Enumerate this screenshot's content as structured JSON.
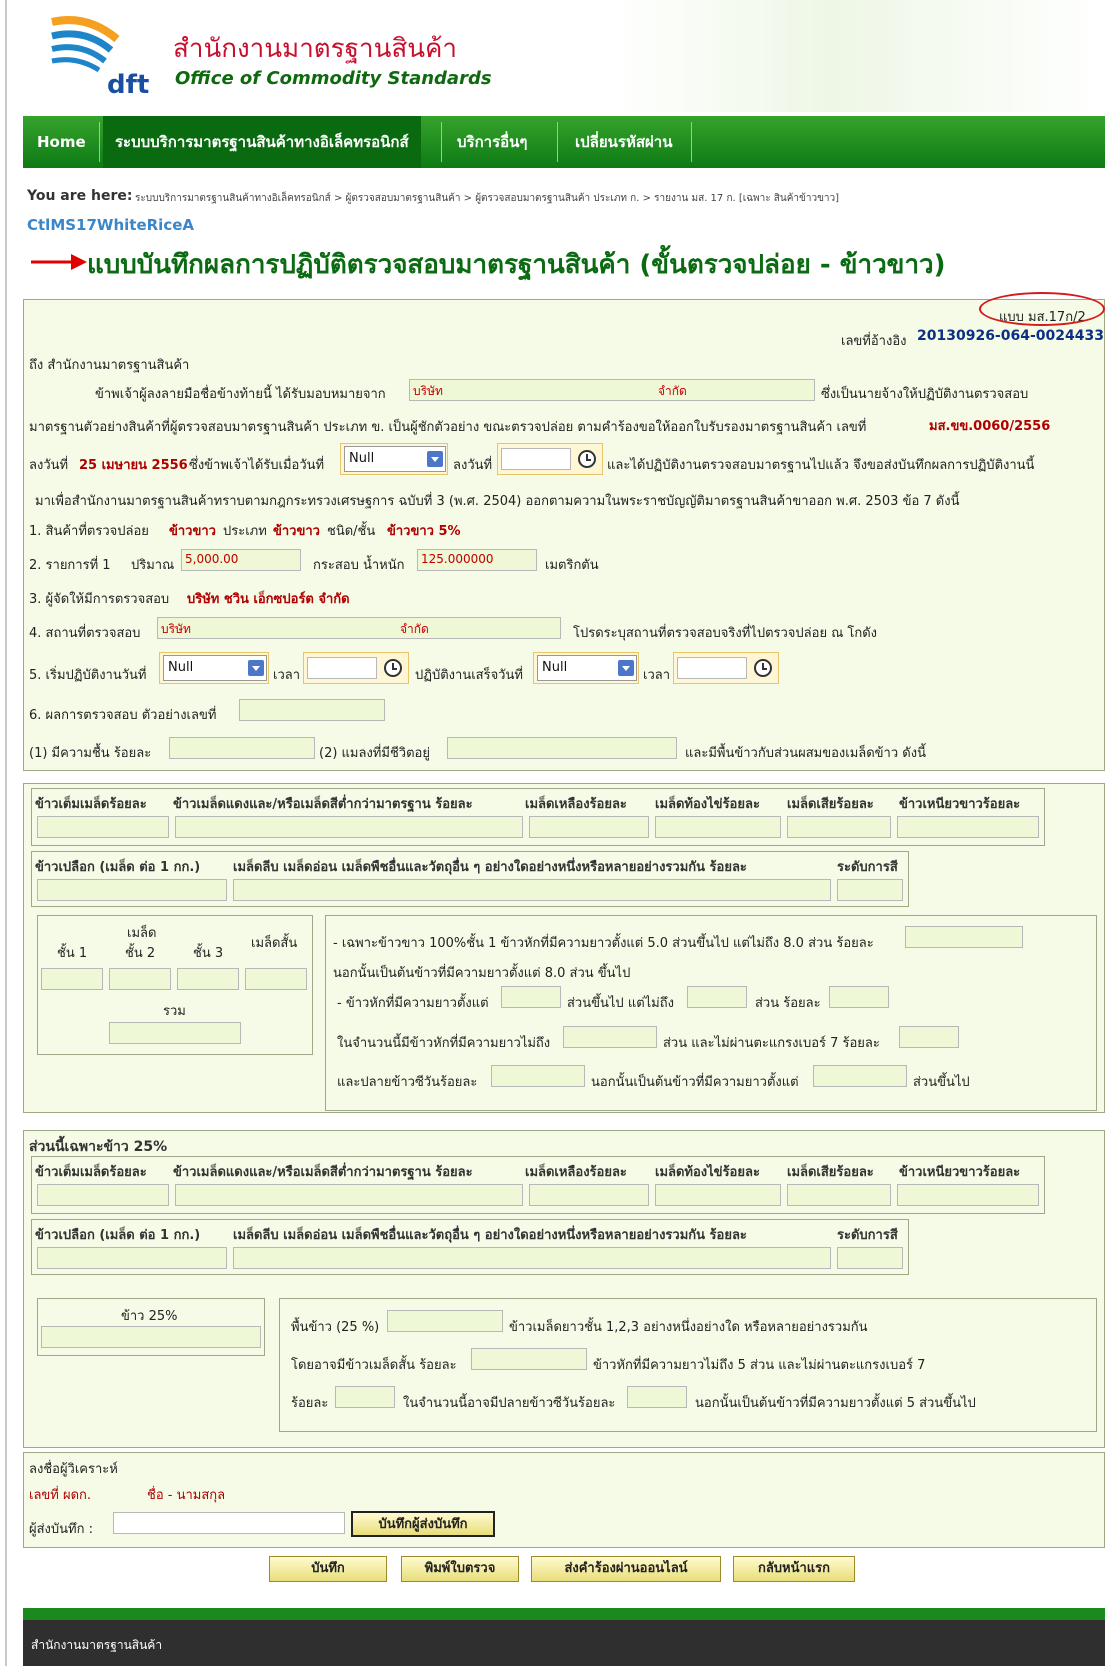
{
  "header": {
    "logo_text": "dft",
    "org_thai": "สำนักงานมาตรฐานสินค้า",
    "org_en": "Office of Commodity Standards"
  },
  "nav": {
    "items": [
      "Home",
      "ระบบบริการมาตรฐานสินค้าทางอิเล็คทรอนิกส์",
      "บริการอื่นๆ",
      "เปลี่ยนรหัสผ่าน"
    ]
  },
  "breadcrumb": {
    "label": "You are here:",
    "path": "ระบบบริการมาตรฐานสินค้าทางอิเล็คทรอนิกส์ > ผู้ตรวจสอบมาตรฐานสินค้า > ผู้ตรวจสอบมาตรฐานสินค้า ประเภท ก. > รายงาน มส. 17 ก. [เฉพาะ สินค้าข้าวขาว]"
  },
  "page": {
    "code": "CtlMS17WhiteRiceA",
    "title": "แบบบันทึกผลการปฏิบัติตรวจสอบมาตรฐานสินค้า (ขั้นตรวจปล่อย - ข้าวขาว)"
  },
  "form": {
    "form_no": "แบบ มส.17ก/2",
    "ref_label": "เลขที่อ้างอิง",
    "ref_no": "20130926-064-0024433",
    "to": "ถึง สำนักงานมาตรฐานสินค้า",
    "p1a": "ข้าพเจ้าผู้ลงลายมือชื่อข้างท้ายนี้ ได้รับมอบหมายจาก",
    "company_field": "บริษัท",
    "company_suffix": "จำกัด",
    "p1b": "ซึ่งเป็นนายจ้างให้ปฏิบัติงานตรวจสอบ",
    "p2": "มาตรฐานตัวอย่างสินค้าที่ผู้ตรวจสอบมาตรฐานสินค้า  ประเภท ข. เป็นผู้ชักตัวอย่าง ขณะตรวจปล่อย ตามคำร้องขอให้ออกใบรับรองมาตรฐานสินค้า เลขที่",
    "cert_no": "มส.ขข.0060/2556",
    "p3a": "ลงวันที่",
    "p3_date": "25 เมษายน 2556",
    "p3b": "ซึ่งข้าพเจ้าได้รับเมื่อวันที่",
    "p3_select": "Null",
    "p3c": "ลงวันที่",
    "p3d": "และได้ปฏิบัติงานตรวจสอบมาตรฐานไปแล้ว จึงขอส่งบันทึกผลการปฏิบัติงานนี้",
    "p4": "มาเพื่อสำนักงานมาตรฐานสินค้าทราบตามกฎกระทรวงเศรษฐการ ฉบับที่ 3 (พ.ศ. 2504) ออกตามความในพระราชบัญญัติมาตรฐานสินค้าขาออก พ.ศ. 2503 ข้อ 7 ดังนี้",
    "item1_a": "1. สินค้าที่ตรวจปล่อย",
    "item1_v1": "ข้าวขาว",
    "item1_b": "ประเภท",
    "item1_v2": "ข้าวขาว",
    "item1_c": "ชนิด/ชั้น",
    "item1_v3": "ข้าวขาว 5%",
    "item2_a": "2. รายการที่ 1",
    "item2_b": "ปริมาณ",
    "item2_qty": "5,000.00",
    "item2_c": "กระสอบ น้ำหนัก",
    "item2_weight": "125.000000",
    "item2_d": "เมตริกตัน",
    "item3_a": "3. ผู้จัดให้มีการตรวจสอบ",
    "item3_v": "บริษัท ชวิน เอ็กซปอร์ต จำกัด",
    "item4_a": "4. สถานที่ตรวจสอบ",
    "item4_field": "บริษัท",
    "item4_suffix": "จำกัด",
    "item4_b": "โปรดระบุสถานที่ตรวจสอบจริงที่ไปตรวจปล่อย ณ โกดัง",
    "item5_a": "5. เริ่มปฏิบัติงานวันที่",
    "item5_select1": "Null",
    "item5_b": "เวลา",
    "item5_c": "ปฏิบัติงานเสร็จวันที่",
    "item5_select2": "Null",
    "item5_d": "เวลา",
    "item6": "6. ผลการตรวจสอบ ตัวอย่างเลขที่",
    "item7_a": "(1) มีความชื้น ร้อยละ",
    "item7_b": "(2) แมลงที่มีชีวิตอยู่",
    "item7_c": "และมีพื้นข้าวกับส่วนผสมของเมล็ดข้าว ดังนี้"
  },
  "section_a": {
    "cols": [
      "ข้าวเต็มเมล็ดร้อยละ",
      "ข้าวเมล็ดแดงและ/หรือเมล็ดสีต่ำกว่ามาตรฐาน ร้อยละ",
      "เมล็ดเหลืองร้อยละ",
      "เมล็ดท้องไข่ร้อยละ",
      "เมล็ดเสียร้อยละ",
      "ข้าวเหนียวขาวร้อยละ"
    ],
    "row2_a": "ข้าวเปลือก (เมล็ด ต่อ 1 กก.)",
    "row2_b": "เมล็ดลีบ เมล็ดอ่อน เมล็ดพืชอื่นและวัตถุอื่น ๆ อย่างใดอย่างหนึ่งหรือหลายอย่างรวมกัน ร้อยละ",
    "row2_c": "ระดับการสี",
    "grade_head": "เมล็ด",
    "grade1": "ชั้น 1",
    "grade2": "ชั้น 2",
    "grade3": "ชั้น 3",
    "short": "เมล็ดสั้น",
    "total": "รวม",
    "r1": "- เฉพาะข้าวขาว 100%ชั้น 1 ข้าวหักที่มีความยาวตั้งแต่ 5.0 ส่วนขึ้นไป แต่ไม่ถึง 8.0 ส่วน ร้อยละ",
    "r2": "นอกนั้นเป็นต้นข้าวที่มีความยาวตั้งแต่ 8.0 ส่วน ขึ้นไป",
    "r3a": "- ข้าวหักที่มีความยาวตั้งแต่",
    "r3b": "ส่วนขึ้นไป แต่ไม่ถึง",
    "r3c": "ส่วน ร้อยละ",
    "r4a": "ในจำนวนนี้มีข้าวหักที่มีความยาวไม่ถึง",
    "r4b": "ส่วน และไม่ผ่านตะแกรงเบอร์ 7 ร้อยละ",
    "r5a": "และปลายข้าวซีวันร้อยละ",
    "r5b": "นอกนั้นเป็นต้นข้าวที่มีความยาวตั้งแต่",
    "r5c": "ส่วนขึ้นไป"
  },
  "section_b": {
    "title": "ส่วนนี้เฉพาะข้าว 25%",
    "cols": [
      "ข้าวเต็มเมล็ดร้อยละ",
      "ข้าวเมล็ดแดงและ/หรือเมล็ดสีต่ำกว่ามาตรฐาน ร้อยละ",
      "เมล็ดเหลืองร้อยละ",
      "เมล็ดท้องไข่ร้อยละ",
      "เมล็ดเสียร้อยละ",
      "ข้าวเหนียวขาวร้อยละ"
    ],
    "row2_a": "ข้าวเปลือก (เมล็ด ต่อ 1 กก.)",
    "row2_b": "เมล็ดลีบ เมล็ดอ่อน เมล็ดพืชอื่นและวัตถุอื่น ๆ อย่างใดอย่างหนึ่งหรือหลายอย่างรวมกัน ร้อยละ",
    "row2_c": "ระดับการสี",
    "rice25": "ข้าว 25%",
    "s1a": "พื้นข้าว (25 %)",
    "s1b": "ข้าวเมล็ดยาวชั้น 1,2,3 อย่างหนึ่งอย่างใด หรือหลายอย่างรวมกัน",
    "s2a": "โดยอาจมีข้าวเมล็ดสั้น ร้อยละ",
    "s2b": "ข้าวหักที่มีความยาวไม่ถึง 5 ส่วน  และไม่ผ่านตะแกรงเบอร์ 7",
    "s3a": "ร้อยละ",
    "s3b": "ในจำนวนนี้อาจมีปลายข้าวซีวันร้อยละ",
    "s3c": "นอกนั้นเป็นต้นข้าวที่มีความยาวตั้งแต่ 5 ส่วนขึ้นไป"
  },
  "signature": {
    "title": "ลงชื่อผู้วิเคราะห์",
    "no_label": "เลขที่ ผดก.",
    "name_label": "ชื่อ - นามสกุล",
    "sender_label": "ผู้ส่งบันทึก :",
    "save_sender_btn": "บันทึกผู้ส่งบันทึก"
  },
  "actions": {
    "save": "บันทึก",
    "print": "พิมพ์ใบตรวจ",
    "submit": "ส่งคำร้องผ่านออนไลน์",
    "home": "กลับหน้าแรก"
  },
  "footer": {
    "text": "สำนักงานมาตรฐานสินค้า"
  },
  "colors": {
    "nav_green": "#0d7a15",
    "title_green": "#0b6b12",
    "value_red": "#b00000",
    "ref_blue": "#0b2f82"
  }
}
